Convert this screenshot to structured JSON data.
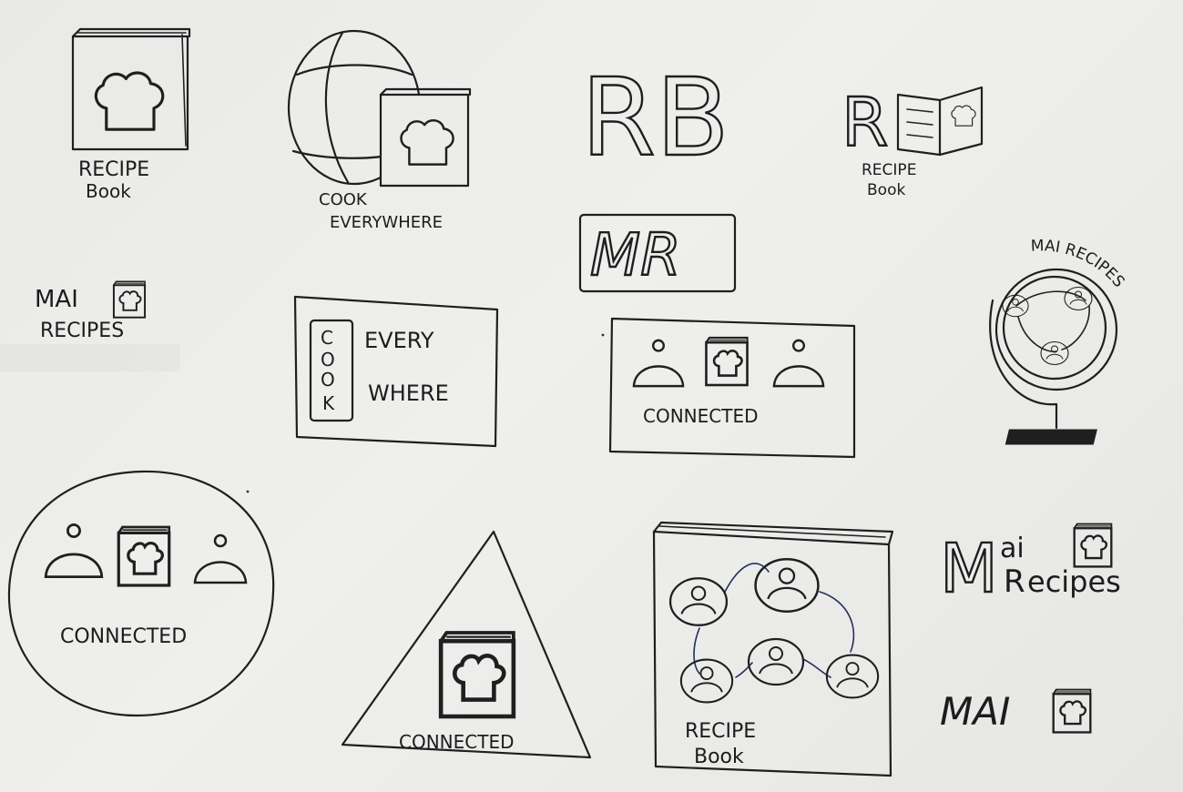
{
  "sketches": {
    "recipe_book_1": {
      "line1": "RECIPE",
      "line2": "Book"
    },
    "cook_everywhere_globe": {
      "line1": "COOK",
      "line2": "EVERYWHERE"
    },
    "rb_monogram": {
      "text": "RB"
    },
    "rb_book": {
      "mono": "R",
      "line1": "RECIPE",
      "line2": "Book"
    },
    "mr_badge": {
      "text": "MR"
    },
    "mai_recipes_small": {
      "line1": "MAI",
      "line2": "RECIPES"
    },
    "cook_everywhere_box": {
      "c1": "C",
      "c2": "O",
      "c3": "O",
      "c4": "K",
      "line1": "EVERY",
      "line2": "WHERE"
    },
    "connected_box": {
      "label": "CONNECTED"
    },
    "globe_stand": {
      "label": "MAI RECIPES"
    },
    "connected_circle": {
      "label": "CONNECTED"
    },
    "connected_triangle": {
      "label": "CONNECTED"
    },
    "network_book": {
      "line1": "RECIPE",
      "line2": "Book"
    },
    "mai_recipes_big": {
      "m": "M",
      "ai": "ai",
      "recipes_r": "R",
      "recipes_rest": "ecipes"
    },
    "mai_icon": {
      "text": "MAI"
    }
  }
}
